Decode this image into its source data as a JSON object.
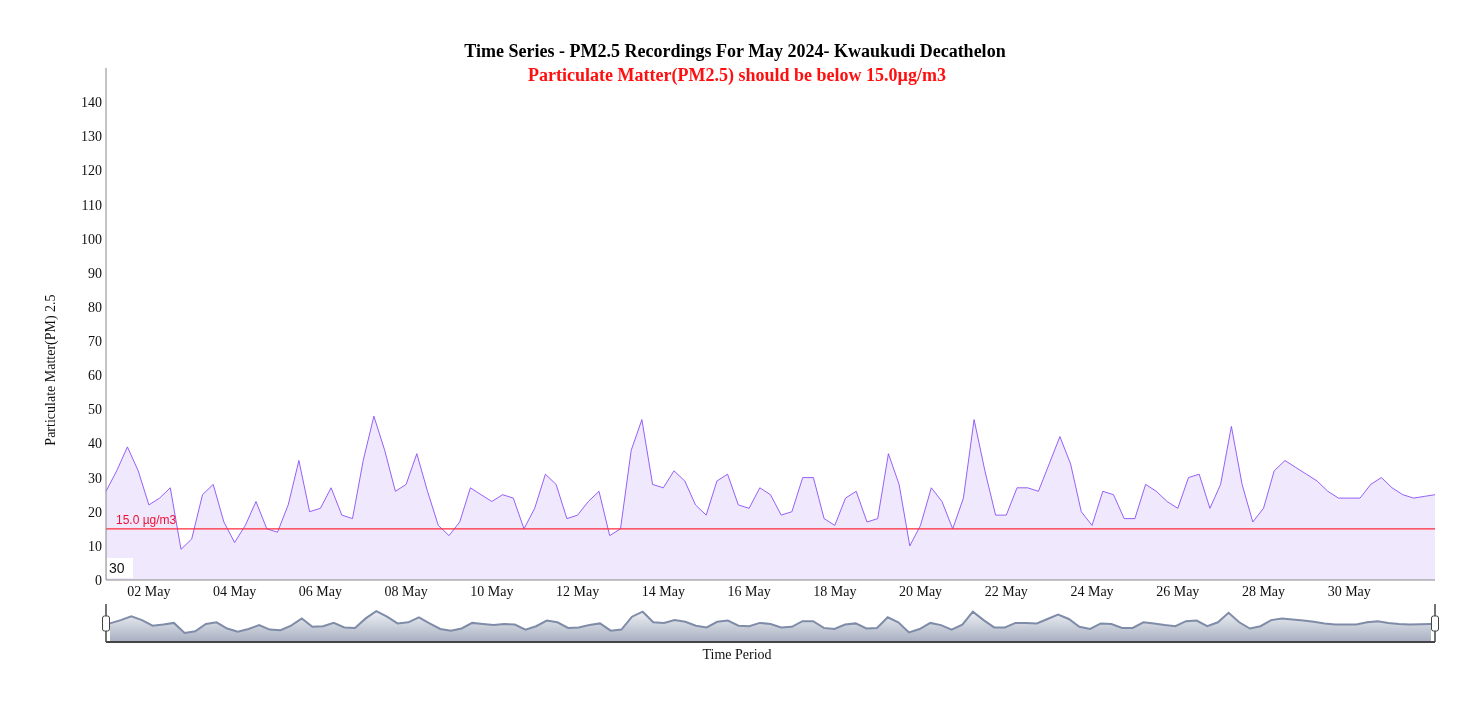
{
  "chart": {
    "subtitle": "Particulate Matter(PM2.5) should be below 15.0µg/m3",
    "corner_label": "30",
    "chart_data": {
      "type": "area",
      "title": "Time Series - PM2.5 Recordings For May 2024- Kwaukudi Decathelon",
      "xlabel": "Time Period",
      "ylabel": "Particulate Matter(PM) 2.5",
      "categories": [
        null,
        null,
        null,
        null,
        "02 May",
        null,
        null,
        null,
        null,
        null,
        null,
        null,
        "04 May",
        null,
        null,
        null,
        null,
        null,
        null,
        null,
        "06 May",
        null,
        null,
        null,
        null,
        null,
        null,
        null,
        "08 May",
        null,
        null,
        null,
        null,
        null,
        null,
        null,
        "10 May",
        null,
        null,
        null,
        null,
        null,
        null,
        null,
        "12 May",
        null,
        null,
        null,
        null,
        null,
        null,
        null,
        "14 May",
        null,
        null,
        null,
        null,
        null,
        null,
        null,
        "16 May",
        null,
        null,
        null,
        null,
        null,
        null,
        null,
        "18 May",
        null,
        null,
        null,
        null,
        null,
        null,
        null,
        "20 May",
        null,
        null,
        null,
        null,
        null,
        null,
        null,
        "22 May",
        null,
        null,
        null,
        null,
        null,
        null,
        null,
        "24 May",
        null,
        null,
        null,
        null,
        null,
        null,
        null,
        "26 May",
        null,
        null,
        null,
        null,
        null,
        null,
        null,
        "28 May",
        null,
        null,
        null,
        null,
        null,
        null,
        null,
        "30 May",
        null,
        null,
        null,
        null,
        null,
        null,
        null,
        null
      ],
      "series": [
        {
          "color": "#8a4ff7",
          "values": [
            26,
            32,
            39,
            32,
            22,
            24,
            27,
            9,
            12,
            25,
            28,
            17,
            11,
            16,
            23,
            15,
            14,
            22,
            35,
            20,
            21,
            27,
            19,
            18,
            35,
            48,
            38,
            26,
            28,
            37,
            26,
            16,
            13,
            17,
            27,
            25,
            23,
            25,
            24,
            15,
            21,
            31,
            28,
            18,
            19,
            23,
            26,
            13,
            15,
            38,
            47,
            28,
            27,
            32,
            29,
            22,
            19,
            29,
            31,
            22,
            21,
            27,
            25,
            19,
            20,
            30,
            30,
            18,
            16,
            24,
            26,
            17,
            18,
            37,
            28,
            10,
            16,
            27,
            23,
            15,
            24,
            47,
            32,
            19,
            19,
            27,
            27,
            26,
            34,
            42,
            34,
            20,
            16,
            26,
            25,
            18,
            18,
            28,
            26,
            23,
            21,
            30,
            31,
            21,
            28,
            45,
            28,
            17,
            21,
            32,
            35,
            33,
            31,
            29,
            26,
            24,
            24,
            24,
            28,
            30,
            27,
            25,
            24,
            24.5,
            25
          ]
        }
      ],
      "ylim": [
        0,
        150
      ],
      "yticks": [
        0,
        10,
        20,
        30,
        40,
        50,
        60,
        70,
        80,
        90,
        100,
        110,
        120,
        130,
        140
      ],
      "ref_lines": [
        {
          "axis": "y",
          "value": 15,
          "label": "15.0 µg/m3",
          "color": "#ff2a3a"
        }
      ]
    }
  }
}
